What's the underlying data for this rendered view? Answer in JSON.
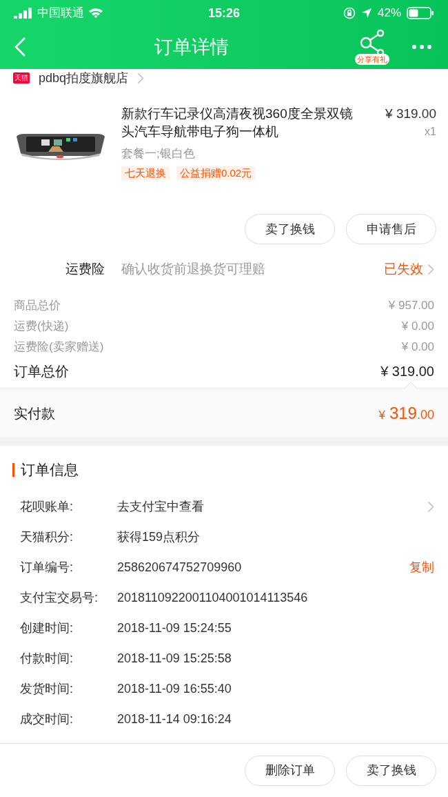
{
  "status_bar": {
    "carrier": "中国联通",
    "time": "15:26",
    "battery": "42%"
  },
  "nav": {
    "title": "订单详情",
    "share_badge": "分享有礼"
  },
  "store": {
    "badge": "天猫",
    "name": "pdbq拍度旗舰店"
  },
  "product": {
    "title": "新款行车记录仪高清夜视360度全景双镜头汽车导航带电子狗一体机",
    "price": "¥ 319.00",
    "quantity": "x1",
    "variant": "套餐一;银白色",
    "tags": [
      "七天退换",
      "公益捐赠0.02元"
    ]
  },
  "item_actions": [
    "卖了换钱",
    "申请售后"
  ],
  "insurance": {
    "label": "运费险",
    "description": "确认收货前退换货可理赔",
    "status": "已失效"
  },
  "summary": [
    {
      "label": "商品总价",
      "value": "¥ 957.00"
    },
    {
      "label": "运费(快递)",
      "value": "¥ 0.00"
    },
    {
      "label": "运费险(卖家赠送)",
      "value": "¥ 0.00"
    }
  ],
  "order_total": {
    "label": "订单总价",
    "value": "¥ 319.00"
  },
  "paid": {
    "label": "实付款",
    "currency": "¥",
    "integer": "319",
    "decimal": ".00"
  },
  "order_info": {
    "title": "订单信息",
    "rows": [
      {
        "kind": "link",
        "label": "花呗账单:",
        "value": "去支付宝中查看"
      },
      {
        "kind": "plain",
        "label": "天猫积分:",
        "value": "获得159点积分"
      },
      {
        "kind": "copy",
        "label": "订单编号:",
        "value": "258620674752709960",
        "action": "复制"
      },
      {
        "kind": "plain",
        "label": "支付宝交易号:",
        "value": "2018110922001104001014113546"
      },
      {
        "kind": "plain",
        "label": "创建时间:",
        "value": "2018-11-09 15:24:55"
      },
      {
        "kind": "plain",
        "label": "付款时间:",
        "value": "2018-11-09 15:25:58"
      },
      {
        "kind": "plain",
        "label": "发货时间:",
        "value": "2018-11-09 16:55:40"
      },
      {
        "kind": "plain",
        "label": "成交时间:",
        "value": "2018-11-14 09:16:24"
      }
    ]
  },
  "bottom_actions": [
    "删除订单",
    "卖了换钱"
  ]
}
